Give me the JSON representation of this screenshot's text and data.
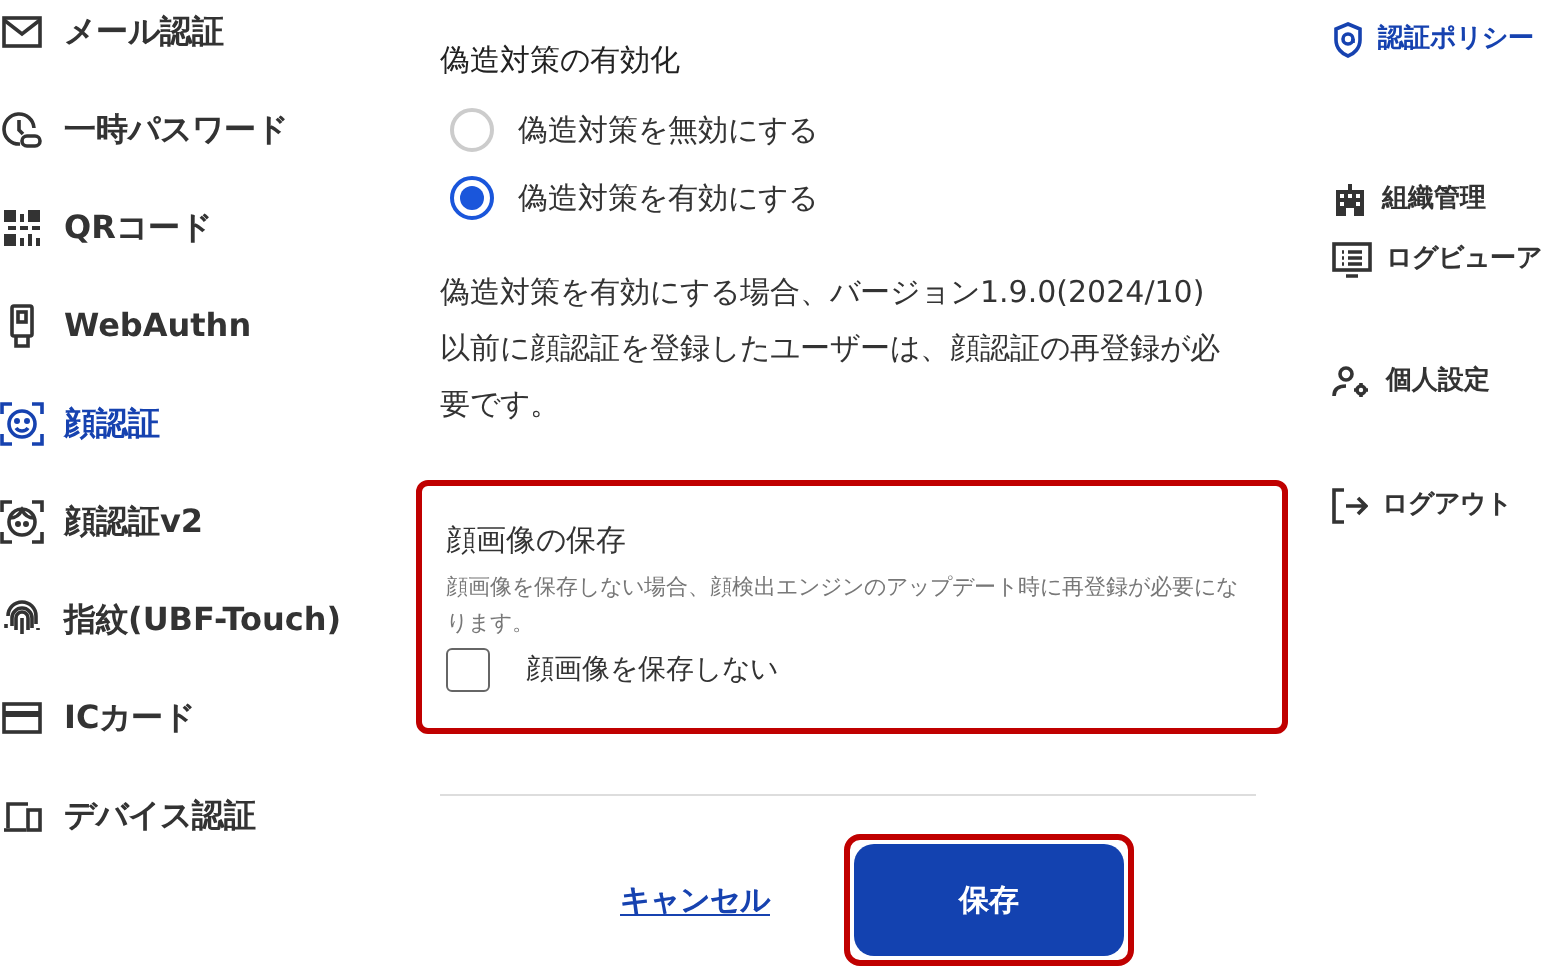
{
  "sidebar": {
    "items": [
      {
        "label": "メール認証",
        "selected": false
      },
      {
        "label": "一時パスワード",
        "selected": false
      },
      {
        "label": "QRコード",
        "selected": false
      },
      {
        "label": "WebAuthn",
        "selected": false
      },
      {
        "label": "顔認証",
        "selected": true
      },
      {
        "label": "顔認証v2",
        "selected": false
      },
      {
        "label": "指紋(UBF-Touch)",
        "selected": false
      },
      {
        "label": "ICカード",
        "selected": false
      },
      {
        "label": "デバイス認証",
        "selected": false
      }
    ]
  },
  "anti_spoofing": {
    "title": "偽造対策の有効化",
    "options": [
      {
        "label": "偽造対策を無効にする",
        "selected": false
      },
      {
        "label": "偽造対策を有効にする",
        "selected": true
      }
    ],
    "note": "偽造対策を有効にする場合、バージョン1.9.0(2024/10)以前に顔認証を登録したユーザーは、顔認証の再登録が必要です。"
  },
  "face_image": {
    "highlighted": true,
    "title": "顔画像の保存",
    "hint": "顔画像を保存しない場合、顔検出エンジンのアップデート時に再登録が必要になります。",
    "checkbox": {
      "label": "顔画像を保存しない",
      "checked": false
    }
  },
  "actions": {
    "cancel": "キャンセル",
    "save": {
      "label": "保存",
      "highlighted": true
    }
  },
  "right_menu": {
    "items": [
      {
        "label": "認証ポリシー",
        "selected": true
      },
      {
        "label": "組織管理",
        "selected": false
      },
      {
        "label": "ログビューア",
        "selected": false
      },
      {
        "label": "個人設定",
        "selected": false
      },
      {
        "label": "ログアウト",
        "selected": false
      }
    ]
  }
}
